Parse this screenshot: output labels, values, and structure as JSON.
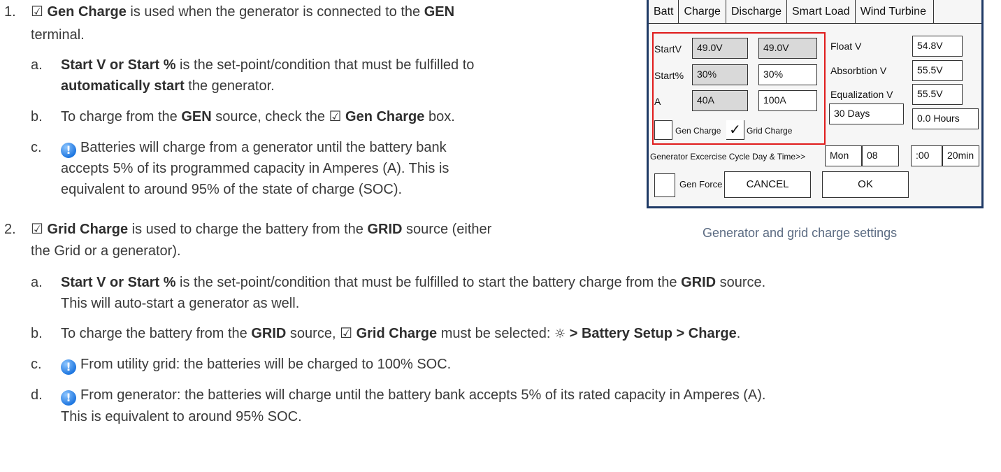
{
  "doc": {
    "item1": {
      "num": "1.",
      "check": "☑",
      "title": "Gen Charge",
      "text1": " is used when the generator is connected to the ",
      "gen": "GEN",
      "text2": "terminal.",
      "a_letter": "a.",
      "a_b1": "Start V or Start %",
      "a_t1": " is the set-point/condition that must be fulfilled to",
      "a_b2": "automatically start",
      "a_t2": " the generator.",
      "b_letter": "b.",
      "b_t1": "To charge from the ",
      "b_gen": "GEN",
      "b_t2": " source, check the ",
      "b_check": "☑",
      "b_title": " Gen Charge",
      "b_t3": " box.",
      "c_letter": "c.",
      "c_t1": "Batteries will charge from a generator until the battery bank",
      "c_t2": "accepts 5% of its programmed capacity in Amperes (A). This is",
      "c_t3": "equivalent to around 95% of the state of charge (SOC)."
    },
    "item2": {
      "num": "2.",
      "check": "☑",
      "title": " Grid Charge",
      "t1": " is used to charge the battery from the ",
      "grid": "GRID",
      "t2": " source (either",
      "t3": "the Grid or a generator).",
      "a_letter": "a.",
      "a_b1": "Start V or Start %",
      "a_t1": " is the set-point/condition that must be fulfilled to start the battery charge from the ",
      "a_grid": "GRID",
      "a_t2": " source.",
      "a_t3": "This will auto-start a generator as well.",
      "b_letter": "b.",
      "b_t1": "To charge the battery from the ",
      "b_grid": "GRID",
      "b_t2": " source, ",
      "b_check": "☑",
      "b_title": " Grid Charge",
      "b_t3": " must be selected: ",
      "b_path": " > Battery Setup > Charge",
      "b_t4": ".",
      "c_letter": "c.",
      "c_t1": "From utility grid: the batteries will be charged to 100% SOC.",
      "d_letter": "d.",
      "d_t1": "From generator: the batteries will charge until the battery bank accepts 5% of its rated capacity in Amperes (A).",
      "d_t2": "This is equivalent to around 95% SOC."
    },
    "caption": "Generator and grid charge settings",
    "icons": {
      "info": "info-icon",
      "gear": "gear-icon",
      "checkbox": "checkbox-checked-icon"
    }
  },
  "panel": {
    "tabs": [
      "Batt",
      "Charge",
      "Discharge",
      "Smart Load",
      "Wind Turbine"
    ],
    "labels": {
      "startv": "StartV",
      "startpct": "Start%",
      "a": "A",
      "float": "Float V",
      "absorb": "Absorbtion V",
      "equal": "Equalization V",
      "gencharge": "Gen Charge",
      "gridcharge": "Grid Charge",
      "exercise": "Generator Excercise Cycle Day & Time>>",
      "genforce": "Gen Force"
    },
    "values": {
      "startv_gen": "49.0V",
      "startv_grid": "49.0V",
      "startpct_gen": "30%",
      "startpct_grid": "30%",
      "a_gen": "40A",
      "a_grid": "100A",
      "float": "54.8V",
      "absorb": "55.5V",
      "equal": "55.5V",
      "days": "30 Days",
      "hours": "0.0 Hours",
      "day": "Mon",
      "hour": "08",
      "minute": ":00",
      "duration": "20min"
    },
    "gridcheck": "✓",
    "buttons": {
      "cancel": "CANCEL",
      "ok": "OK"
    }
  }
}
